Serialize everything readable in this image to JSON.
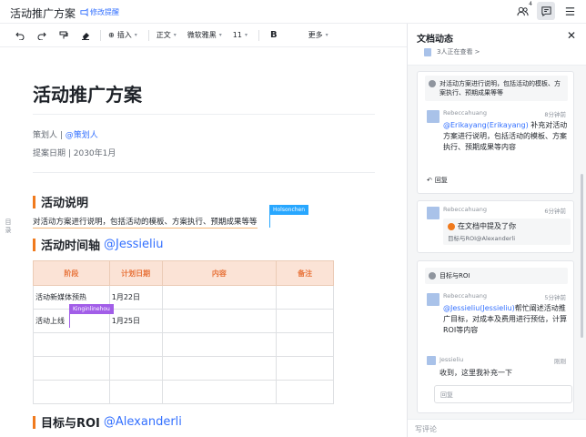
{
  "topbar": {
    "doc_name": "活动推广方案",
    "remind_label": "修改提醒",
    "collab_count": "4"
  },
  "toolbar": {
    "insert": "插入",
    "style": "正文",
    "font": "微软雅黑",
    "size": "11",
    "bold": "B",
    "more": "更多"
  },
  "doc": {
    "outline_toggle": "目录",
    "title": "活动推广方案",
    "planner_label": "策划人 | ",
    "planner_mention": "@策划人",
    "date_line": "提案日期 | 2030年1月",
    "section1": "活动说明",
    "section1_text": "对活动方案进行说明，包括活动的模板、方案执行、预期成果等等",
    "cursor1_name": "Holsonchen",
    "section2": "活动时间轴",
    "section2_mention": "@Jessieliu",
    "table": {
      "headers": [
        "阶段",
        "计划日期",
        "内容",
        "备注"
      ],
      "rows": [
        [
          "活动新媒体预热",
          "1月22日",
          "",
          ""
        ],
        [
          "活动上线",
          "1月25日",
          "",
          ""
        ],
        [
          "",
          "",
          "",
          ""
        ],
        [
          "",
          "",
          "",
          ""
        ],
        [
          "",
          "",
          "",
          ""
        ]
      ]
    },
    "cursor2_name": "Kinginlinehou",
    "section3": "目标与ROI",
    "section3_mention": "@Alexanderli"
  },
  "panel": {
    "title": "文档动态",
    "viewers": "3人正在查看 >",
    "card1": {
      "quote": "对活动方案进行说明，包括活动的模板、方案执行、预期成果等等",
      "user": "Rebeccahuang",
      "time": "8分钟前",
      "mention": "@Erikayang(Erikayang)",
      "text": " 补充对活动方案进行说明，包括活动的模板、方案执行、预期成果等内容",
      "reply": "回复"
    },
    "card2": {
      "user": "Rebeccahuang",
      "time": "6分钟前",
      "notice_title": "在文档中提及了你",
      "notice_sub": "目标与ROI@Alexanderli"
    },
    "card3": {
      "quote": "目标与ROI",
      "user": "Rebeccahuang",
      "time": "5分钟前",
      "mention": "@Jessieliu(Jessieliu)",
      "text": "帮忙阐述活动推广目标，对成本及费用进行预估，计算ROI等内容",
      "user2": "Jessieliu",
      "time2": "刚刚",
      "text2": "收到，这里我补充一下",
      "reply_placeholder": "回复"
    },
    "write_comment": "写评论"
  },
  "colors": {
    "accent": "#3370ff",
    "heading_bar": "#f07a1d",
    "table_header_bg": "#fbe3d6",
    "table_header_text": "#e8743b",
    "cursor1": "#28a7ff",
    "cursor2": "#a25ee8"
  }
}
